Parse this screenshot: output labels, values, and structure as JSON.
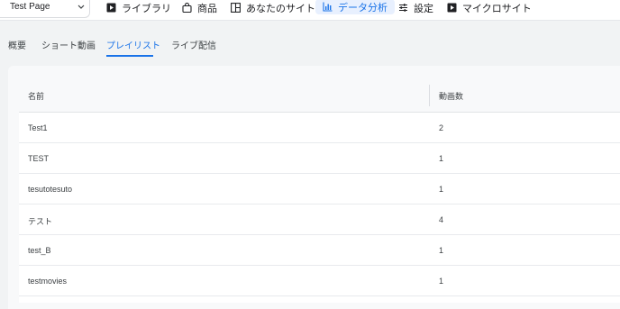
{
  "topbar": {
    "page_selector": "Test Page",
    "nav": [
      {
        "label": "ライブラリ",
        "icon": "play-square-icon"
      },
      {
        "label": "商品",
        "icon": "shopping-bag-icon"
      },
      {
        "label": "あなたのサイト",
        "icon": "layout-icon"
      },
      {
        "label": "データ分析",
        "icon": "bar-chart-icon",
        "active": true
      },
      {
        "label": "設定",
        "icon": "sliders-icon"
      },
      {
        "label": "マイクロサイト",
        "icon": "play-square-icon"
      }
    ]
  },
  "tabs": [
    "概要",
    "ショート動画",
    "プレイリスト",
    "ライブ配信"
  ],
  "active_tab": "プレイリスト",
  "table": {
    "columns": [
      "名前",
      "動画数"
    ],
    "rows": [
      {
        "name": "Test1",
        "count": "2"
      },
      {
        "name": "TEST",
        "count": "1"
      },
      {
        "name": "tesutotesuto",
        "count": "1"
      },
      {
        "name": "テスト",
        "count": "4"
      },
      {
        "name": "test_B",
        "count": "1"
      },
      {
        "name": "testmovies",
        "count": "1"
      }
    ]
  },
  "colors": {
    "accent": "#1a73e8",
    "active_bg": "#e8f0fe"
  }
}
